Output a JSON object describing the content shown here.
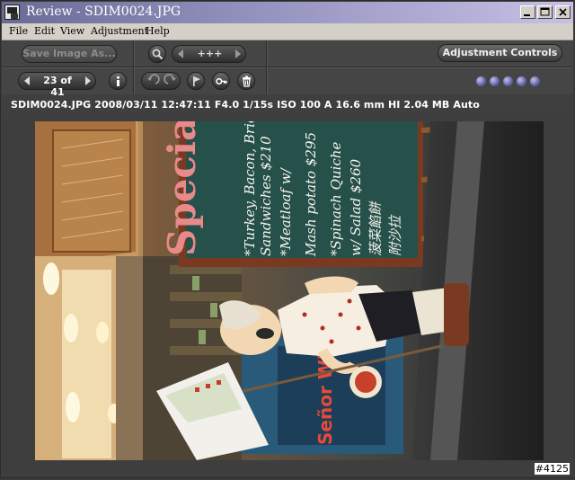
{
  "window": {
    "title": "Review - SDIM0024.JPG"
  },
  "menu": {
    "items": [
      "File",
      "Edit",
      "View",
      "Adjustment",
      "Help"
    ]
  },
  "toolbar": {
    "save_label": "Save Image As...",
    "counter_label": "23 of 41",
    "zoom_label": "+++",
    "adjustment_controls_label": "Adjustment Controls",
    "status_lights": 5
  },
  "info": {
    "text": "SDIM0024.JPG   2008/03/11   12:47:11   F4.0   1/15s   ISO 100   A   16.6 mm   HI   2.04 MB   Auto"
  },
  "photo": {
    "board_text": "Specials",
    "menu_lines": [
      "*Turkey, Bacon, Brie Cheese",
      "Sandwiches $210",
      "*Meatloaf w/",
      "Mash potato $295",
      "*Spinach Quiche",
      "w/ Salad $260",
      "菠菜餡餅",
      "附沙拉"
    ],
    "poster_text": "Señor Wiener"
  },
  "watermark": "#4125"
}
